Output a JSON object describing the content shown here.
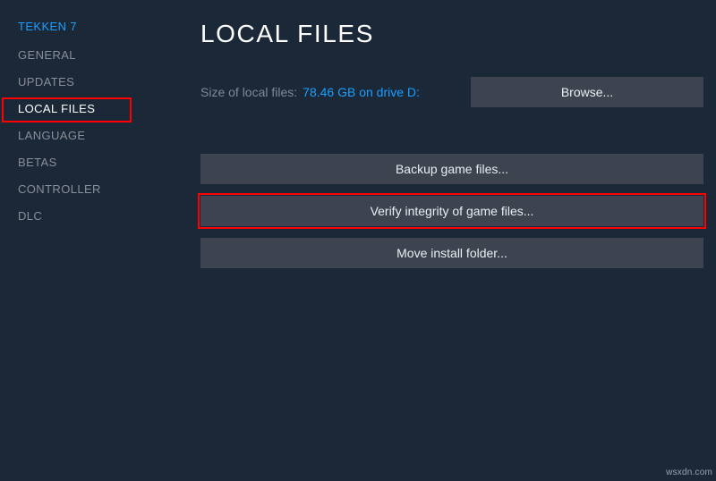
{
  "sidebar": {
    "game_title": "TEKKEN 7",
    "items": [
      {
        "label": "GENERAL"
      },
      {
        "label": "UPDATES"
      },
      {
        "label": "LOCAL FILES",
        "active": true,
        "highlighted": true
      },
      {
        "label": "LANGUAGE"
      },
      {
        "label": "BETAS"
      },
      {
        "label": "CONTROLLER"
      },
      {
        "label": "DLC"
      }
    ]
  },
  "main": {
    "title": "LOCAL FILES",
    "size_label": "Size of local files:",
    "size_value": "78.46 GB on drive D:",
    "browse_label": "Browse...",
    "actions": {
      "backup": "Backup game files...",
      "verify": "Verify integrity of game files...",
      "move": "Move install folder..."
    }
  },
  "watermark": "wsxdn.com"
}
